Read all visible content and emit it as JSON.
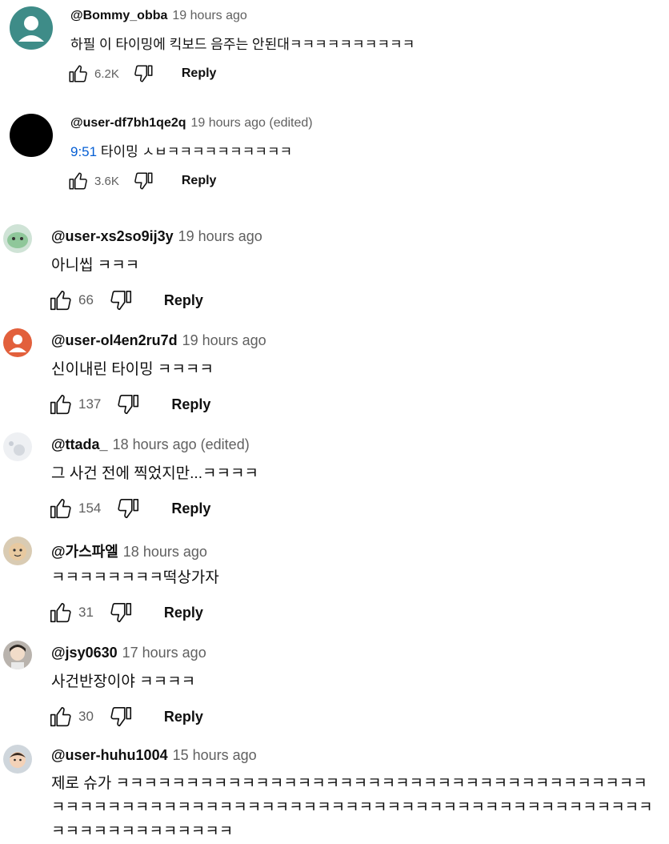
{
  "comments": [
    {
      "author": "@Bommy_obba",
      "time": "19 hours ago",
      "text": "하필 이 타이밍에 킥보드 음주는 안된대ㅋㅋㅋㅋㅋㅋㅋㅋㅋㅋ",
      "likes": "6.2K",
      "reply": "Reply",
      "avatar": "default-avatar-teal"
    },
    {
      "author": "@user-df7bh1qe2q",
      "time": "19 hours ago (edited)",
      "timestamp_link": "9:51",
      "text": " 타이밍 ㅅㅂㅋㅋㅋㅋㅋㅋㅋㅋㅋㅋ",
      "likes": "3.6K",
      "reply": "Reply",
      "avatar": "black-circle"
    },
    {
      "author": "@user-xs2so9ij3y",
      "time": "19 hours ago",
      "text": "아니씹 ㅋㅋㅋ",
      "likes": "66",
      "reply": "Reply",
      "avatar": "green-character"
    },
    {
      "author": "@user-ol4en2ru7d",
      "time": "19 hours ago",
      "text": "신이내린 타이밍 ㅋㅋㅋㅋ",
      "likes": "137",
      "reply": "Reply",
      "avatar": "default-avatar-orange"
    },
    {
      "author": "@ttada_",
      "time": "18 hours ago (edited)",
      "text": "그 사건 전에 찍었지만...ㅋㅋㅋㅋ",
      "likes": "154",
      "reply": "Reply",
      "avatar": "photo-light"
    },
    {
      "author": "@가스파엘",
      "time": "18 hours ago",
      "text": "ㅋㅋㅋㅋㅋㅋㅋㅋ떡상가자",
      "likes": "31",
      "reply": "Reply",
      "avatar": "cartoon-face"
    },
    {
      "author": "@jsy0630",
      "time": "17 hours ago",
      "text": "사건반장이야 ㅋㅋㅋㅋ",
      "likes": "30",
      "reply": "Reply",
      "avatar": "photo-person"
    },
    {
      "author": "@user-huhu1004",
      "time": "15 hours ago",
      "text": "제로 슈가 ㅋㅋㅋㅋㅋㅋㅋㅋㅋㅋㅋㅋㅋㅋㅋㅋㅋㅋㅋㅋㅋㅋㅋㅋㅋㅋㅋㅋㅋㅋㅋㅋㅋㅋㅋㅋㅋㅋㅋㅋㅋㅋㅋㅋㅋㅋㅋㅋㅋㅋㅋㅋㅋㅋㅋㅋㅋㅋㅋㅋㅋㅋㅋㅋㅋㅋㅋㅋㅋㅋㅋㅋㅋㅋㅋㅋㅋㅋㅋㅋㅋㅋㅋㅋㅋㅋㅋㅋㅋㅋㅋㅋㅋㅋ",
      "avatar": "photo-child"
    }
  ],
  "colors": {
    "link": "#065fd4",
    "meta": "#606060",
    "text": "#0f0f0f"
  }
}
